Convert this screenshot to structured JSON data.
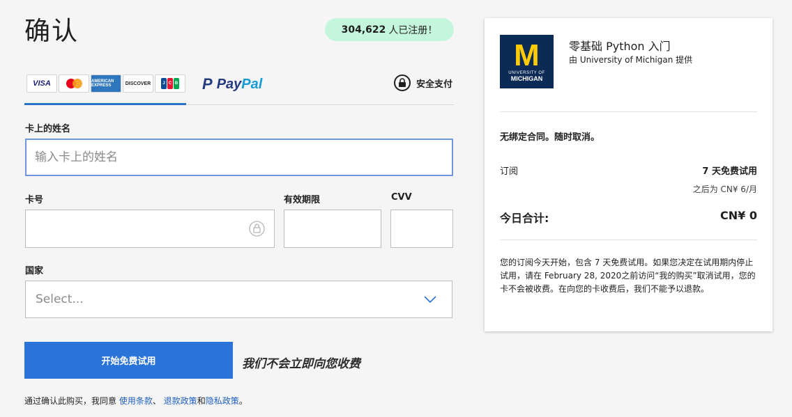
{
  "page": {
    "title": "确认"
  },
  "enroll_badge": {
    "count": "304,622",
    "text": "人已注册！"
  },
  "tabs": {
    "cards": [
      "VISA",
      "MasterCard",
      "AMERICAN EXPRESS",
      "DISCOVER",
      "JCB"
    ],
    "paypal_pay": "Pay",
    "paypal_pal": "Pal",
    "secure_label": "安全支付"
  },
  "form": {
    "name_label": "卡上的姓名",
    "name_placeholder": "输入卡上的姓名",
    "card_number_label": "卡号",
    "expiry_label": "有效期限",
    "cvv_label": "CVV",
    "country_label": "国家",
    "country_placeholder": "Select..."
  },
  "cta": {
    "button_label": "开始免费试用",
    "no_charge_note": "我们不会立即向您收费"
  },
  "terms": {
    "prefix": "通过确认此购买，我同意 ",
    "terms_link": "使用条款",
    "sep1": "、 ",
    "refund_link": "退款政策",
    "sep2": "和",
    "privacy_link": "隐私政策",
    "suffix": "。"
  },
  "summary": {
    "logo_m": "M",
    "logo_line1": "UNIVERSITY OF",
    "logo_line2": "MICHIGAN",
    "course_title": "零基础 Python 入门",
    "course_provider": "由 University of Michigan 提供",
    "no_contract": "无绑定合同。随时取消。",
    "subscription_label": "订阅",
    "subscription_value": "7 天免费试用",
    "after_price": "之后为 CN¥ 6/月",
    "total_label": "今日合计:",
    "total_value": "CN¥ 0",
    "policy_text": "您的订阅今天开始，包含 7 天免费试用。如果您决定在试用期内停止试用，请在 February 28, 2020之前访问“我的购买”取消试用，您的卡不会被收费。在向您的卡收费后，我们不能予以退款。"
  },
  "colors": {
    "accent": "#2a73d8",
    "badge_bg": "#c4f5dd",
    "link": "#1f5fbf",
    "michigan_blue": "#0b2a55",
    "michigan_maize": "#ffcb05"
  }
}
